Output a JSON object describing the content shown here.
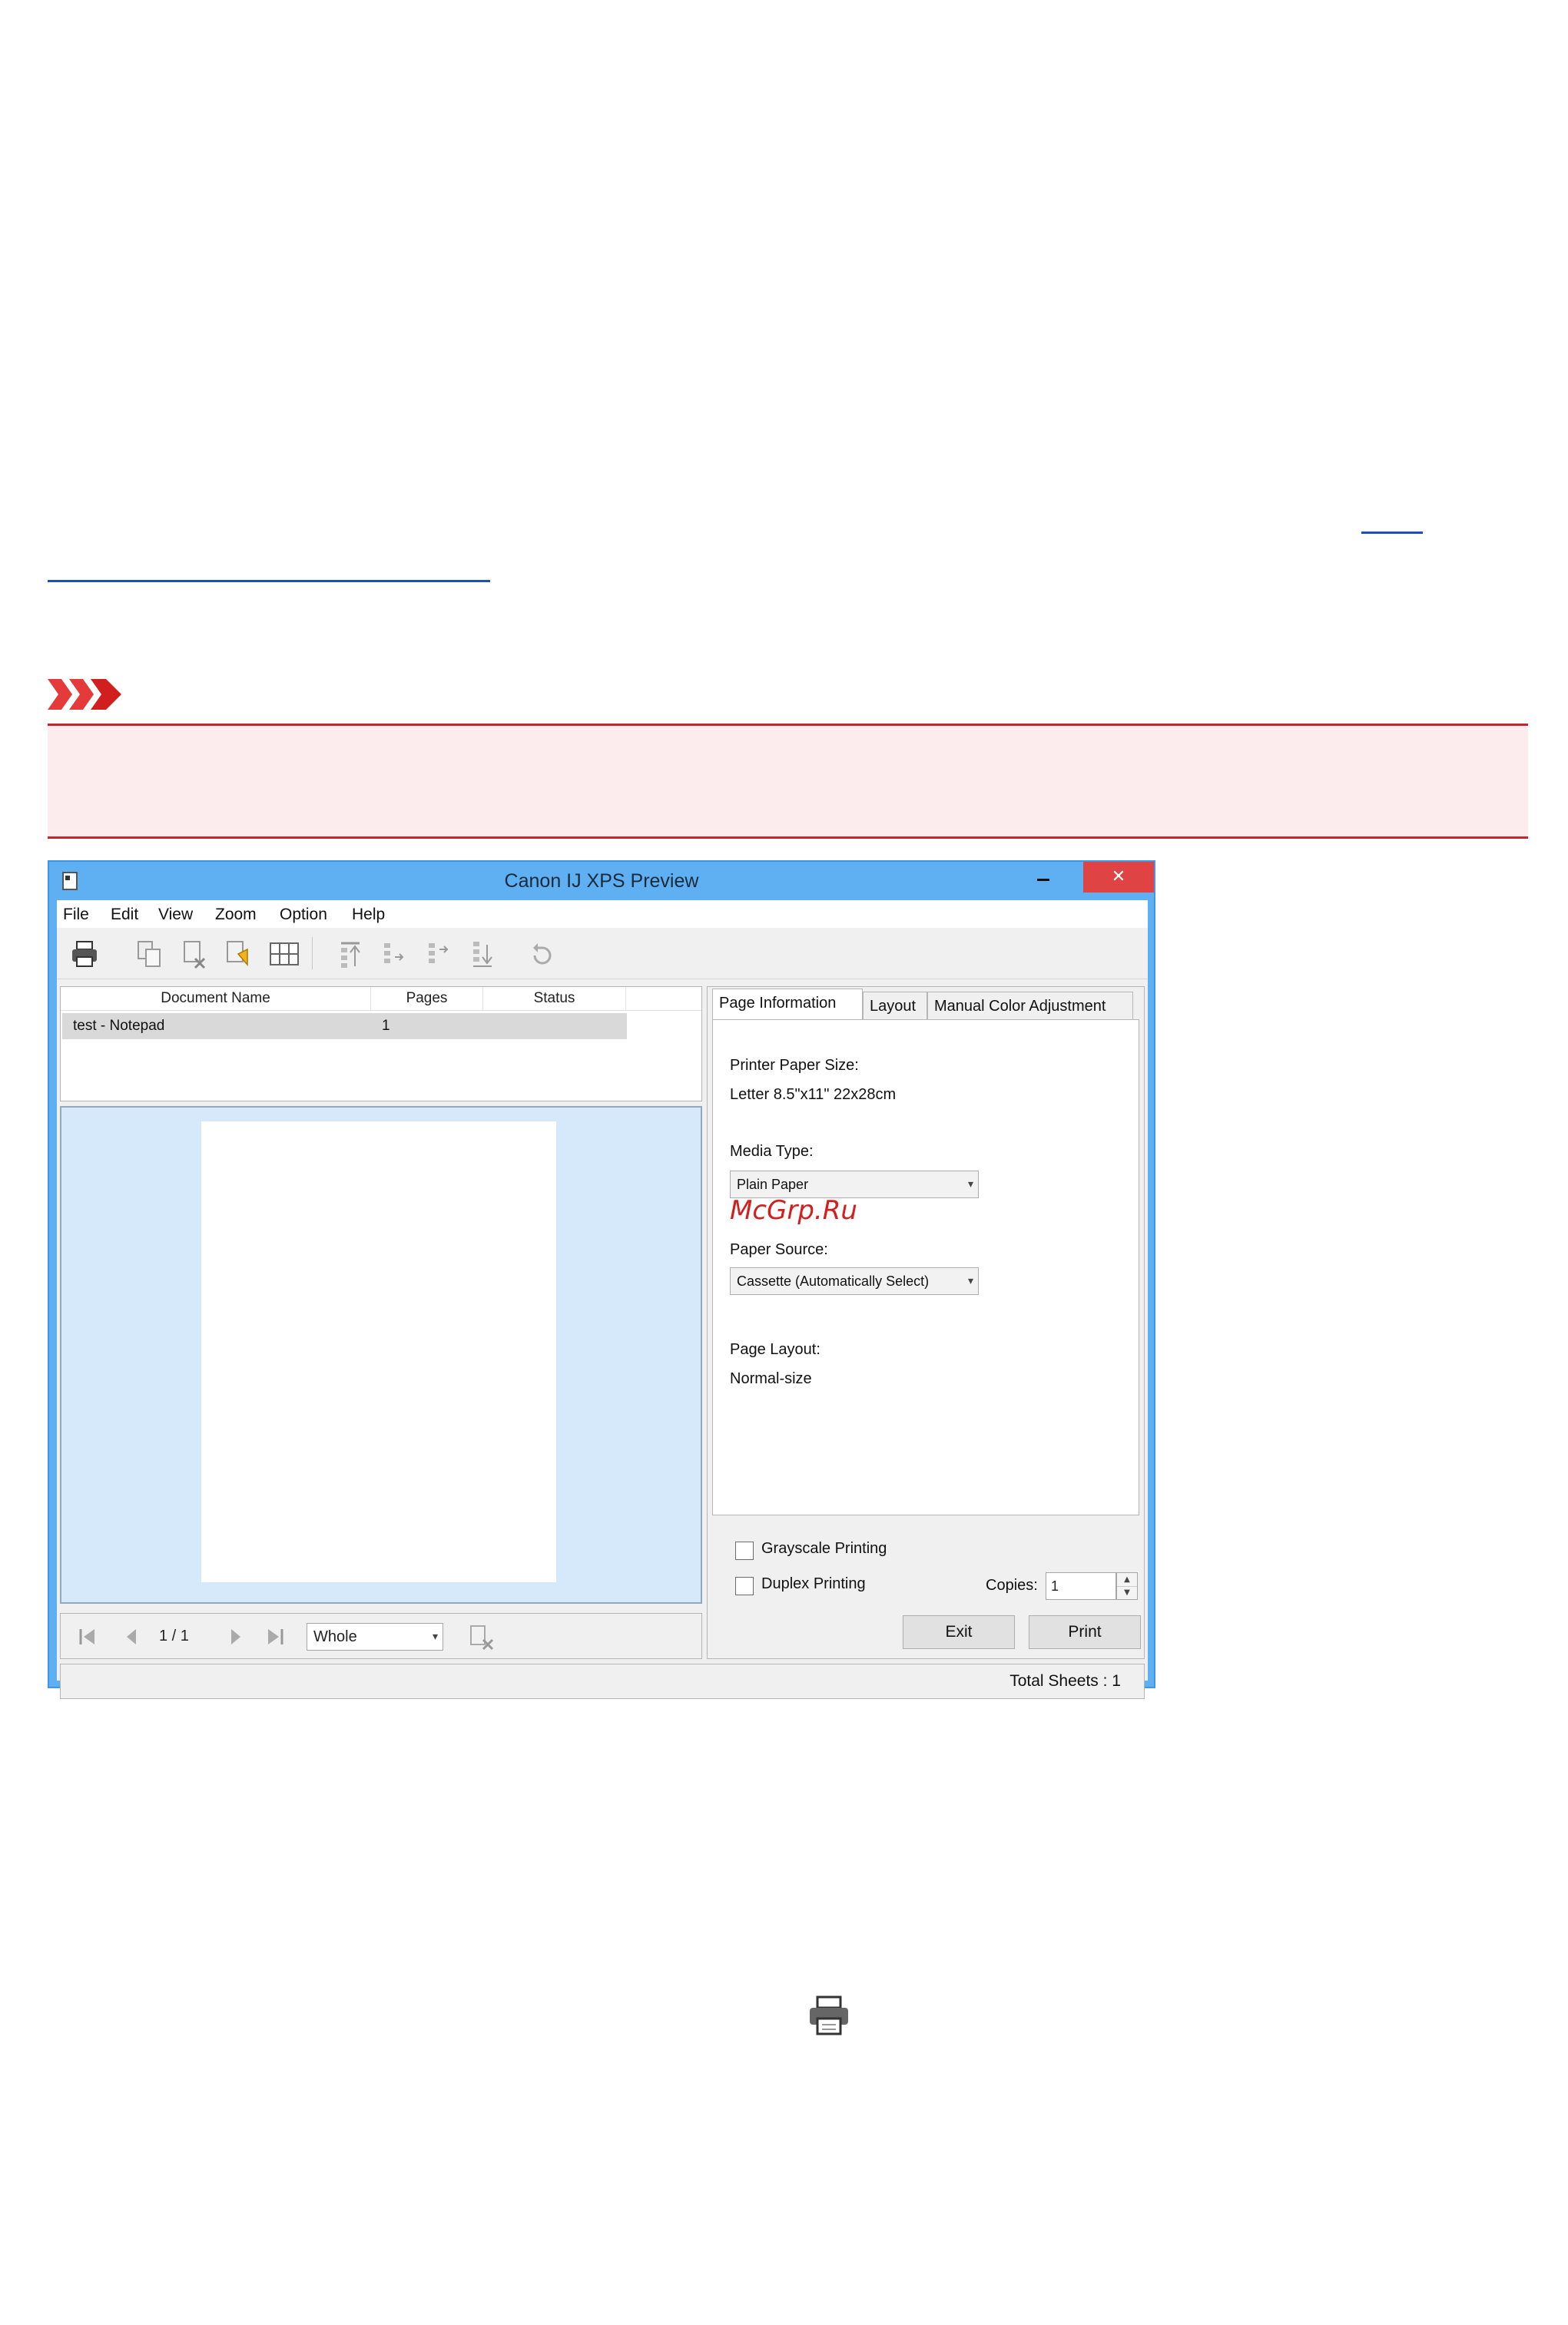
{
  "window": {
    "title": "Canon IJ XPS Preview",
    "close_glyph": "✕"
  },
  "menu": [
    "File",
    "Edit",
    "View",
    "Zoom",
    "Option",
    "Help"
  ],
  "toolbar_icons": [
    "print-icon",
    "combine-documents-icon",
    "delete-document-icon",
    "reset-documents-icon",
    "view-thumbnails-icon",
    "move-to-first-icon",
    "move-up-icon",
    "move-down-icon",
    "move-to-last-icon",
    "undo-icon"
  ],
  "document_list": {
    "columns": [
      "Document Name",
      "Pages",
      "Status"
    ],
    "rows": [
      {
        "name": "test - Notepad",
        "pages": "1",
        "status": ""
      }
    ]
  },
  "navigation": {
    "page_counter": "1 / 1",
    "zoom": "Whole"
  },
  "tabs": [
    "Page Information",
    "Layout",
    "Manual Color Adjustment"
  ],
  "page_information": {
    "printer_paper_size_label": "Printer Paper Size:",
    "printer_paper_size_value": "Letter 8.5\"x11\" 22x28cm",
    "media_type_label": "Media Type:",
    "media_type_value": "Plain Paper",
    "paper_source_label": "Paper Source:",
    "paper_source_value": "Cassette (Automatically Select)",
    "page_layout_label": "Page Layout:",
    "page_layout_value": "Normal-size"
  },
  "watermark": "McGrp.Ru",
  "options": {
    "grayscale_label": "Grayscale Printing",
    "duplex_label": "Duplex Printing",
    "copies_label": "Copies:",
    "copies_value": "1"
  },
  "buttons": {
    "exit": "Exit",
    "print": "Print"
  },
  "status_bar": {
    "total_sheets": "Total Sheets :  1"
  },
  "colors": {
    "window_frame": "#5fb0f2",
    "close_button": "#e04343",
    "important_border": "#c8242b",
    "important_fill": "#fdeced",
    "link": "#1f4fbf",
    "preview_bg": "#d5e9fb",
    "watermark": "#d21f1f"
  }
}
